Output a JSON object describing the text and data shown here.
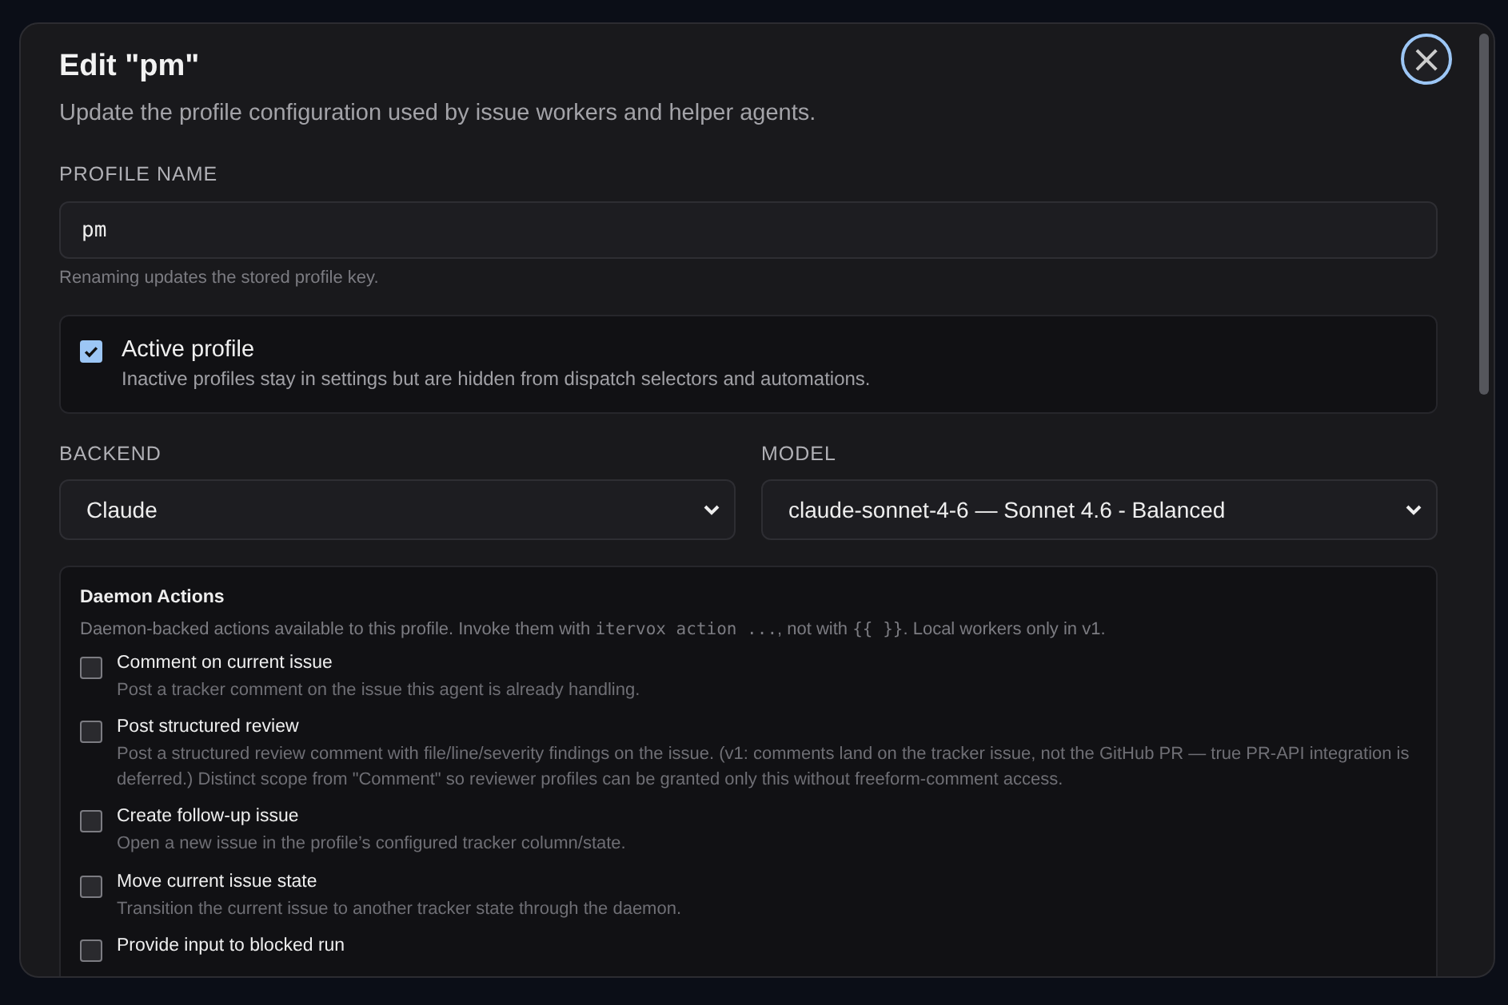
{
  "dialog": {
    "title": "Edit \"pm\"",
    "subtitle": "Update the profile configuration used by issue workers and helper agents.",
    "close_label": "×"
  },
  "profile_name": {
    "label": "PROFILE NAME",
    "value": "pm",
    "hint": "Renaming updates the stored profile key."
  },
  "active": {
    "label": "Active profile",
    "description": "Inactive profiles stay in settings but are hidden from dispatch selectors and automations.",
    "checked": true
  },
  "selects": [
    {
      "label": "BACKEND",
      "value": "Claude"
    },
    {
      "label": "MODEL",
      "value": "claude-sonnet-4-6 — Sonnet 4.6 - Balanced"
    }
  ],
  "daemon_actions": {
    "title": "Daemon Actions",
    "description": [
      {
        "kind": "text",
        "text": "Daemon-backed actions available to this profile. Invoke them with "
      },
      {
        "kind": "code",
        "text": "itervox action ..."
      },
      {
        "kind": "text",
        "text": ", not with "
      },
      {
        "kind": "code",
        "text": "{{ }}"
      },
      {
        "kind": "text",
        "text": ". Local workers only in v1."
      }
    ],
    "items": [
      {
        "label": "Comment on current issue",
        "description": "Post a tracker comment on the issue this agent is already handling.",
        "checked": false
      },
      {
        "label": "Post structured review",
        "description": "Post a structured review comment with file/line/severity findings on the issue. (v1: comments land on the tracker issue, not the GitHub PR — true PR-API integration is deferred.) Distinct scope from \"Comment\" so reviewer profiles can be granted only this without freeform-comment access.",
        "checked": false
      },
      {
        "label": "Create follow-up issue",
        "description": "Open a new issue in the profile’s configured tracker column/state.",
        "checked": false
      },
      {
        "label": "Move current issue state",
        "description": "Transition the current issue to another tracker state through the daemon.",
        "checked": false
      },
      {
        "label": "Provide input to blocked run",
        "checked": false
      }
    ]
  }
}
